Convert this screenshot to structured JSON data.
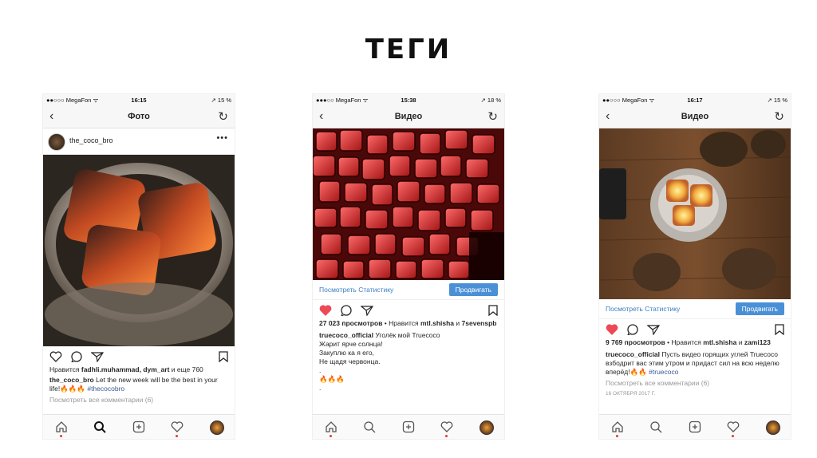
{
  "title": "ТЕГИ",
  "phones": [
    {
      "status": {
        "carrier": "●●○○○ MegaFon ᯤ",
        "time": "16:15",
        "battery": "↗ 15 %"
      },
      "nav_title": "Фото",
      "username": "the_coco_bro",
      "likes_line_prefix": "Нравится ",
      "likes_users": "fadhli.muhammad, dym_art",
      "likes_suffix": " и еще 760",
      "caption_user": "the_coco_bro",
      "caption_text": " Let the new week will be the best in your life!🔥🔥🔥 ",
      "caption_tag": "#thecocobro",
      "comments": "Посмотреть все комментарии (6)"
    },
    {
      "status": {
        "carrier": "●●●○○ MegaFon ᯤ",
        "time": "15:38",
        "battery": "↗ 18 %"
      },
      "nav_title": "Видео",
      "promo_stats": "Посмотреть Статистику",
      "promo_button": "Продвигать",
      "views": "27 023 просмотров",
      "liked_by": " • Нравится ",
      "liked_users": "mtl.shisha",
      "liked_and": " и ",
      "liked_user2": "7sevenspb",
      "caption_user": "truecoco_official",
      "caption_lines": [
        " Уголёк мой Truecoco",
        "Жарит ярче солнца!",
        "Закуплю ка я его,",
        "Не щадя червонца.",
        ".",
        "🔥🔥🔥",
        "."
      ]
    },
    {
      "status": {
        "carrier": "●●○○○ MegaFon ᯤ",
        "time": "16:17",
        "battery": "↗ 15 %"
      },
      "nav_title": "Видео",
      "promo_stats": "Посмотреть Статистику",
      "promo_button": "Продвигать",
      "views": "9 769 просмотров",
      "liked_by": " • Нравится ",
      "liked_users": "mtl.shisha",
      "liked_and": " и ",
      "liked_user2": "zami123",
      "caption_user": "truecoco_official",
      "caption_text": " Пусть видео горящих углей Truecoco взбодрит вас этим утром и придаст сил на всю неделю вперёд!🔥🔥 ",
      "caption_tag": "#truecoco",
      "comments": "Посмотреть все комментарии (6)",
      "date": "16 ОКТЯБРЯ 2017 Г."
    }
  ],
  "icons": {
    "tab_home": "home-icon",
    "tab_search": "search-icon",
    "tab_add": "add-icon",
    "tab_activity": "heart-icon",
    "tab_profile": "profile-avatar"
  }
}
